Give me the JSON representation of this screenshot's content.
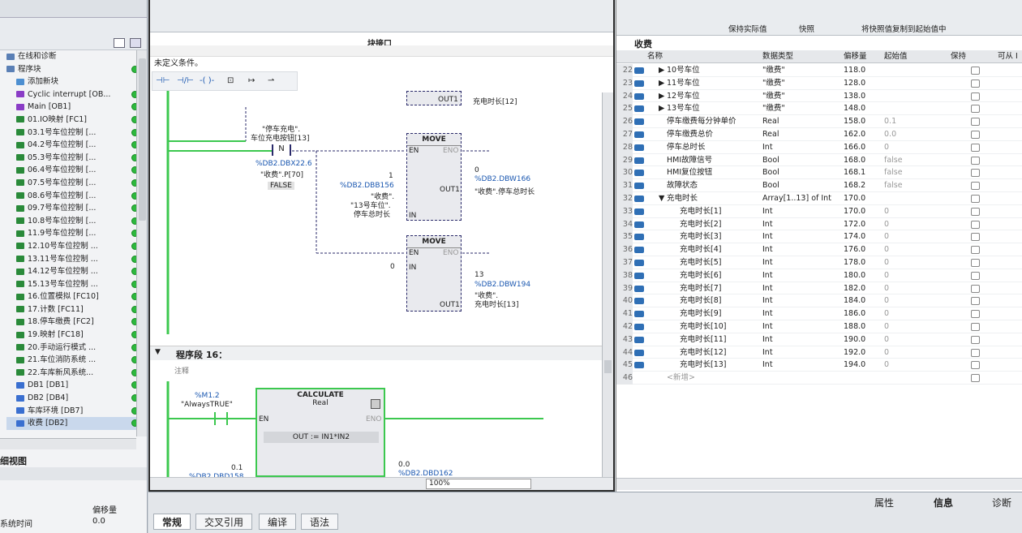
{
  "left": {
    "items": [
      {
        "label": "在线和诊断",
        "color": "#5a7fb5",
        "dot": false
      },
      {
        "label": "程序块",
        "color": "#5a7fb5",
        "dot": true
      },
      {
        "label": "添加新块",
        "color": "#4d8fd1",
        "dot": false
      },
      {
        "label": "Cyclic interrupt [OB...",
        "color": "#8a3cc6",
        "dot": true
      },
      {
        "label": "Main [OB1]",
        "color": "#8a3cc6",
        "dot": true
      },
      {
        "label": "01.IO映射 [FC1]",
        "color": "#2a8a3a",
        "dot": true
      },
      {
        "label": "03.1号车位控制 [...",
        "color": "#2a8a3a",
        "dot": true
      },
      {
        "label": "04.2号车位控制 [...",
        "color": "#2a8a3a",
        "dot": true
      },
      {
        "label": "05.3号车位控制 [...",
        "color": "#2a8a3a",
        "dot": true
      },
      {
        "label": "06.4号车位控制 [...",
        "color": "#2a8a3a",
        "dot": true
      },
      {
        "label": "07.5号车位控制 [...",
        "color": "#2a8a3a",
        "dot": true
      },
      {
        "label": "08.6号车位控制 [...",
        "color": "#2a8a3a",
        "dot": true
      },
      {
        "label": "09.7号车位控制 [...",
        "color": "#2a8a3a",
        "dot": true
      },
      {
        "label": "10.8号车位控制 [...",
        "color": "#2a8a3a",
        "dot": true
      },
      {
        "label": "11.9号车位控制 [...",
        "color": "#2a8a3a",
        "dot": true
      },
      {
        "label": "12.10号车位控制 ...",
        "color": "#2a8a3a",
        "dot": true
      },
      {
        "label": "13.11号车位控制 ...",
        "color": "#2a8a3a",
        "dot": true
      },
      {
        "label": "14.12号车位控制 ...",
        "color": "#2a8a3a",
        "dot": true
      },
      {
        "label": "15.13号车位控制 ...",
        "color": "#2a8a3a",
        "dot": true
      },
      {
        "label": "16.位置模拟 [FC10]",
        "color": "#2a8a3a",
        "dot": true
      },
      {
        "label": "17.计数 [FC11]",
        "color": "#2a8a3a",
        "dot": true
      },
      {
        "label": "18.停车缴费 [FC2]",
        "color": "#2a8a3a",
        "dot": true
      },
      {
        "label": "19.映射 [FC18]",
        "color": "#2a8a3a",
        "dot": true
      },
      {
        "label": "20.手动运行模式 ...",
        "color": "#2a8a3a",
        "dot": true
      },
      {
        "label": "21.车位消防系统 ...",
        "color": "#2a8a3a",
        "dot": true
      },
      {
        "label": "22.车库新风系统...",
        "color": "#2a8a3a",
        "dot": true
      },
      {
        "label": "DB1 [DB1]",
        "color": "#3a6fd0",
        "dot": true
      },
      {
        "label": "DB2 [DB4]",
        "color": "#3a6fd0",
        "dot": true
      },
      {
        "label": "车库环境 [DB7]",
        "color": "#3a6fd0",
        "dot": true
      },
      {
        "label": "收费 [DB2]",
        "color": "#3a6fd0",
        "dot": true
      }
    ],
    "detail_title": "细视图",
    "detail_col": "偏移量",
    "detail_row_label": "系统时间",
    "detail_row_value": "0.0"
  },
  "center": {
    "block_interface": "块接口",
    "condition": "未定义条件。",
    "zoom": "100%",
    "segment16": "程序段 16：",
    "comment": "注释",
    "ladder": {
      "top_out": "OUT1",
      "top_out_var": "充电时长[12]",
      "contact_name1": "\"停车充电\".",
      "contact_name2": "车位充电按钮[13]",
      "contact_sym": "N",
      "addr1": "%DB2.DBX22.6",
      "addr1b": "\"收费\".P[70]",
      "false_label": "FALSE",
      "move1_title": "MOVE",
      "en": "EN",
      "eno": "ENO",
      "in": "IN",
      "out1": "OUT1",
      "m1_in_val": "1",
      "m1_in_addr": "%DB2.DBB156",
      "m1_in_l1": "\"收费\".",
      "m1_in_l2": "\"13号车位\".",
      "m1_in_l3": "停车总时长",
      "m1_out_val": "0",
      "m1_out_addr": "%DB2.DBW166",
      "m1_out_name": "\"收费\".停车总时长",
      "move2_title": "MOVE",
      "m2_in": "0",
      "m2_out_val": "13",
      "m2_out_addr": "%DB2.DBW194",
      "m2_out_l1": "\"收费\".",
      "m2_out_l2": "充电时长[13]",
      "m12": "%M1.2",
      "always_true": "\"AlwaysTRUE\"",
      "calc_title": "CALCULATE",
      "calc_type": "Real",
      "calc_expr": "OUT := IN1*IN2",
      "bottom_val1": "0.1",
      "bottom_addr1": "%DB2.DBD158",
      "bottom_val2": "0.0",
      "bottom_addr2": "%DB2.DBD162"
    }
  },
  "right": {
    "toolbar": {
      "keep": "保持实际值",
      "snapshot": "快照",
      "copy": "将快照值复制到起始值中"
    },
    "db_title": "收费",
    "headers": {
      "name": "名称",
      "type": "数据类型",
      "offset": "偏移量",
      "start": "起始值",
      "retain": "保持",
      "access": "可从 I"
    },
    "rows": [
      {
        "n": "22",
        "name": "10号车位",
        "type": "\"缴费\"",
        "off": "118.0",
        "start": "",
        "exp": true,
        "ind": 1
      },
      {
        "n": "23",
        "name": "11号车位",
        "type": "\"缴费\"",
        "off": "128.0",
        "start": "",
        "exp": true,
        "ind": 1
      },
      {
        "n": "24",
        "name": "12号车位",
        "type": "\"缴费\"",
        "off": "138.0",
        "start": "",
        "exp": true,
        "ind": 1
      },
      {
        "n": "25",
        "name": "13号车位",
        "type": "\"缴费\"",
        "off": "148.0",
        "start": "",
        "exp": true,
        "ind": 1
      },
      {
        "n": "26",
        "name": "停车缴费每分钟单价",
        "type": "Real",
        "off": "158.0",
        "start": "0.1",
        "exp": false,
        "ind": 0
      },
      {
        "n": "27",
        "name": "停车缴费总价",
        "type": "Real",
        "off": "162.0",
        "start": "0.0",
        "exp": false,
        "ind": 0
      },
      {
        "n": "28",
        "name": "停车总时长",
        "type": "Int",
        "off": "166.0",
        "start": "0",
        "exp": false,
        "ind": 0
      },
      {
        "n": "29",
        "name": "HMI故障信号",
        "type": "Bool",
        "off": "168.0",
        "start": "false",
        "exp": false,
        "ind": 0
      },
      {
        "n": "30",
        "name": "HMI复位按钮",
        "type": "Bool",
        "off": "168.1",
        "start": "false",
        "exp": false,
        "ind": 0
      },
      {
        "n": "31",
        "name": "故障状态",
        "type": "Bool",
        "off": "168.2",
        "start": "false",
        "exp": false,
        "ind": 0
      },
      {
        "n": "32",
        "name": "充电时长",
        "type": "Array[1..13] of Int",
        "off": "170.0",
        "start": "",
        "exp": true,
        "ind": 1
      },
      {
        "n": "33",
        "name": "充电时长[1]",
        "type": "Int",
        "off": "170.0",
        "start": "0",
        "exp": false,
        "ind": 2
      },
      {
        "n": "34",
        "name": "充电时长[2]",
        "type": "Int",
        "off": "172.0",
        "start": "0",
        "exp": false,
        "ind": 2
      },
      {
        "n": "35",
        "name": "充电时长[3]",
        "type": "Int",
        "off": "174.0",
        "start": "0",
        "exp": false,
        "ind": 2
      },
      {
        "n": "36",
        "name": "充电时长[4]",
        "type": "Int",
        "off": "176.0",
        "start": "0",
        "exp": false,
        "ind": 2
      },
      {
        "n": "37",
        "name": "充电时长[5]",
        "type": "Int",
        "off": "178.0",
        "start": "0",
        "exp": false,
        "ind": 2
      },
      {
        "n": "38",
        "name": "充电时长[6]",
        "type": "Int",
        "off": "180.0",
        "start": "0",
        "exp": false,
        "ind": 2
      },
      {
        "n": "39",
        "name": "充电时长[7]",
        "type": "Int",
        "off": "182.0",
        "start": "0",
        "exp": false,
        "ind": 2
      },
      {
        "n": "40",
        "name": "充电时长[8]",
        "type": "Int",
        "off": "184.0",
        "start": "0",
        "exp": false,
        "ind": 2
      },
      {
        "n": "41",
        "name": "充电时长[9]",
        "type": "Int",
        "off": "186.0",
        "start": "0",
        "exp": false,
        "ind": 2
      },
      {
        "n": "42",
        "name": "充电时长[10]",
        "type": "Int",
        "off": "188.0",
        "start": "0",
        "exp": false,
        "ind": 2
      },
      {
        "n": "43",
        "name": "充电时长[11]",
        "type": "Int",
        "off": "190.0",
        "start": "0",
        "exp": false,
        "ind": 2
      },
      {
        "n": "44",
        "name": "充电时长[12]",
        "type": "Int",
        "off": "192.0",
        "start": "0",
        "exp": false,
        "ind": 2
      },
      {
        "n": "45",
        "name": "充电时长[13]",
        "type": "Int",
        "off": "194.0",
        "start": "0",
        "exp": false,
        "ind": 2
      },
      {
        "n": "46",
        "name": "<新增>",
        "type": "",
        "off": "",
        "start": "",
        "exp": false,
        "ind": 0
      }
    ]
  },
  "bottom": {
    "tabs": [
      "常规",
      "交叉引用",
      "编译",
      "语法"
    ],
    "right_tabs": {
      "props": "属性",
      "info": "信息",
      "diag": "诊断"
    }
  }
}
